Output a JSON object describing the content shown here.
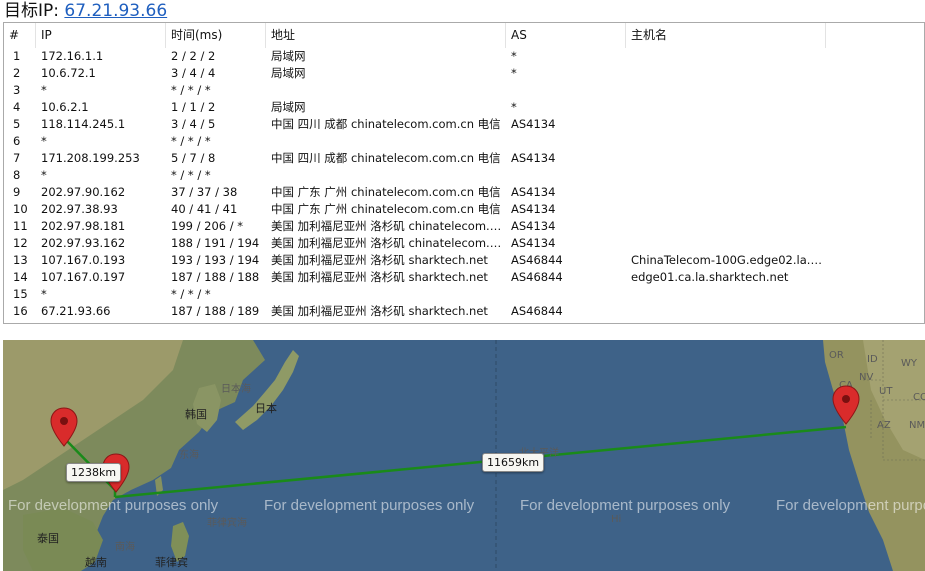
{
  "header": {
    "label": "目标IP:",
    "ip": "67.21.93.66"
  },
  "table": {
    "columns": [
      "#",
      "IP",
      "时间(ms)",
      "地址",
      "AS",
      "主机名"
    ],
    "rows": [
      [
        "1",
        "172.16.1.1",
        "2 / 2 / 2",
        "局域网",
        "*",
        ""
      ],
      [
        "2",
        "10.6.72.1",
        "3 / 4 / 4",
        "局域网",
        "*",
        ""
      ],
      [
        "3",
        "*",
        "* / * / *",
        "",
        "",
        ""
      ],
      [
        "4",
        "10.6.2.1",
        "1 / 1 / 2",
        "局域网",
        "*",
        ""
      ],
      [
        "5",
        "118.114.245.1",
        "3 / 4 / 5",
        "中国 四川 成都 chinatelecom.com.cn 电信",
        "AS4134",
        ""
      ],
      [
        "6",
        "*",
        "* / * / *",
        "",
        "",
        ""
      ],
      [
        "7",
        "171.208.199.253",
        "5 / 7 / 8",
        "中国 四川 成都 chinatelecom.com.cn 电信",
        "AS4134",
        ""
      ],
      [
        "8",
        "*",
        "* / * / *",
        "",
        "",
        ""
      ],
      [
        "9",
        "202.97.90.162",
        "37 / 37 / 38",
        "中国 广东 广州 chinatelecom.com.cn 电信",
        "AS4134",
        ""
      ],
      [
        "10",
        "202.97.38.93",
        "40 / 41 / 41",
        "中国 广东 广州 chinatelecom.com.cn 电信",
        "AS4134",
        ""
      ],
      [
        "11",
        "202.97.98.181",
        "199 / 206 / *",
        "美国 加利福尼亚州 洛杉矶 chinatelecom.c...",
        "AS4134",
        ""
      ],
      [
        "12",
        "202.97.93.162",
        "188 / 191 / 194",
        "美国 加利福尼亚州 洛杉矶 chinatelecom.c...",
        "AS4134",
        ""
      ],
      [
        "13",
        "107.167.0.193",
        "193 / 193 / 194",
        "美国 加利福尼亚州 洛杉矶 sharktech.net",
        "AS46844",
        "ChinaTelecom-100G.edge02.la.ca.s..."
      ],
      [
        "14",
        "107.167.0.197",
        "187 / 188 / 188",
        "美国 加利福尼亚州 洛杉矶 sharktech.net",
        "AS46844",
        "edge01.ca.la.sharktech.net"
      ],
      [
        "15",
        "*",
        "* / * / *",
        "",
        "",
        ""
      ],
      [
        "16",
        "67.21.93.66",
        "187 / 188 / 189",
        "美国 加利福尼亚州 洛杉矶 sharktech.net",
        "AS46844",
        ""
      ]
    ]
  },
  "map": {
    "labels": {
      "japan_sea": "日本海",
      "korea": "韩国",
      "japan": "日本",
      "east_sea": "东海",
      "pacific": "北太平洋",
      "thailand": "泰国",
      "vietnam": "越南",
      "south_sea": "南海",
      "philippines": "菲律宾",
      "philippine_sea": "菲律宾海",
      "hawaii": "Hi",
      "state_or": "OR",
      "state_id": "ID",
      "state_wy": "WY",
      "state_ut": "UT",
      "state_co": "CO",
      "state_az": "AZ",
      "state_nm": "NM",
      "state_nv": "NV",
      "state_ca": "CA"
    },
    "distances": {
      "short": "1238km",
      "long": "11659km"
    },
    "watermark": "For development purposes only",
    "colors": {
      "route": "#1a8a1a",
      "pin": "#d92b2b",
      "ocean": "#3b5f82"
    }
  }
}
